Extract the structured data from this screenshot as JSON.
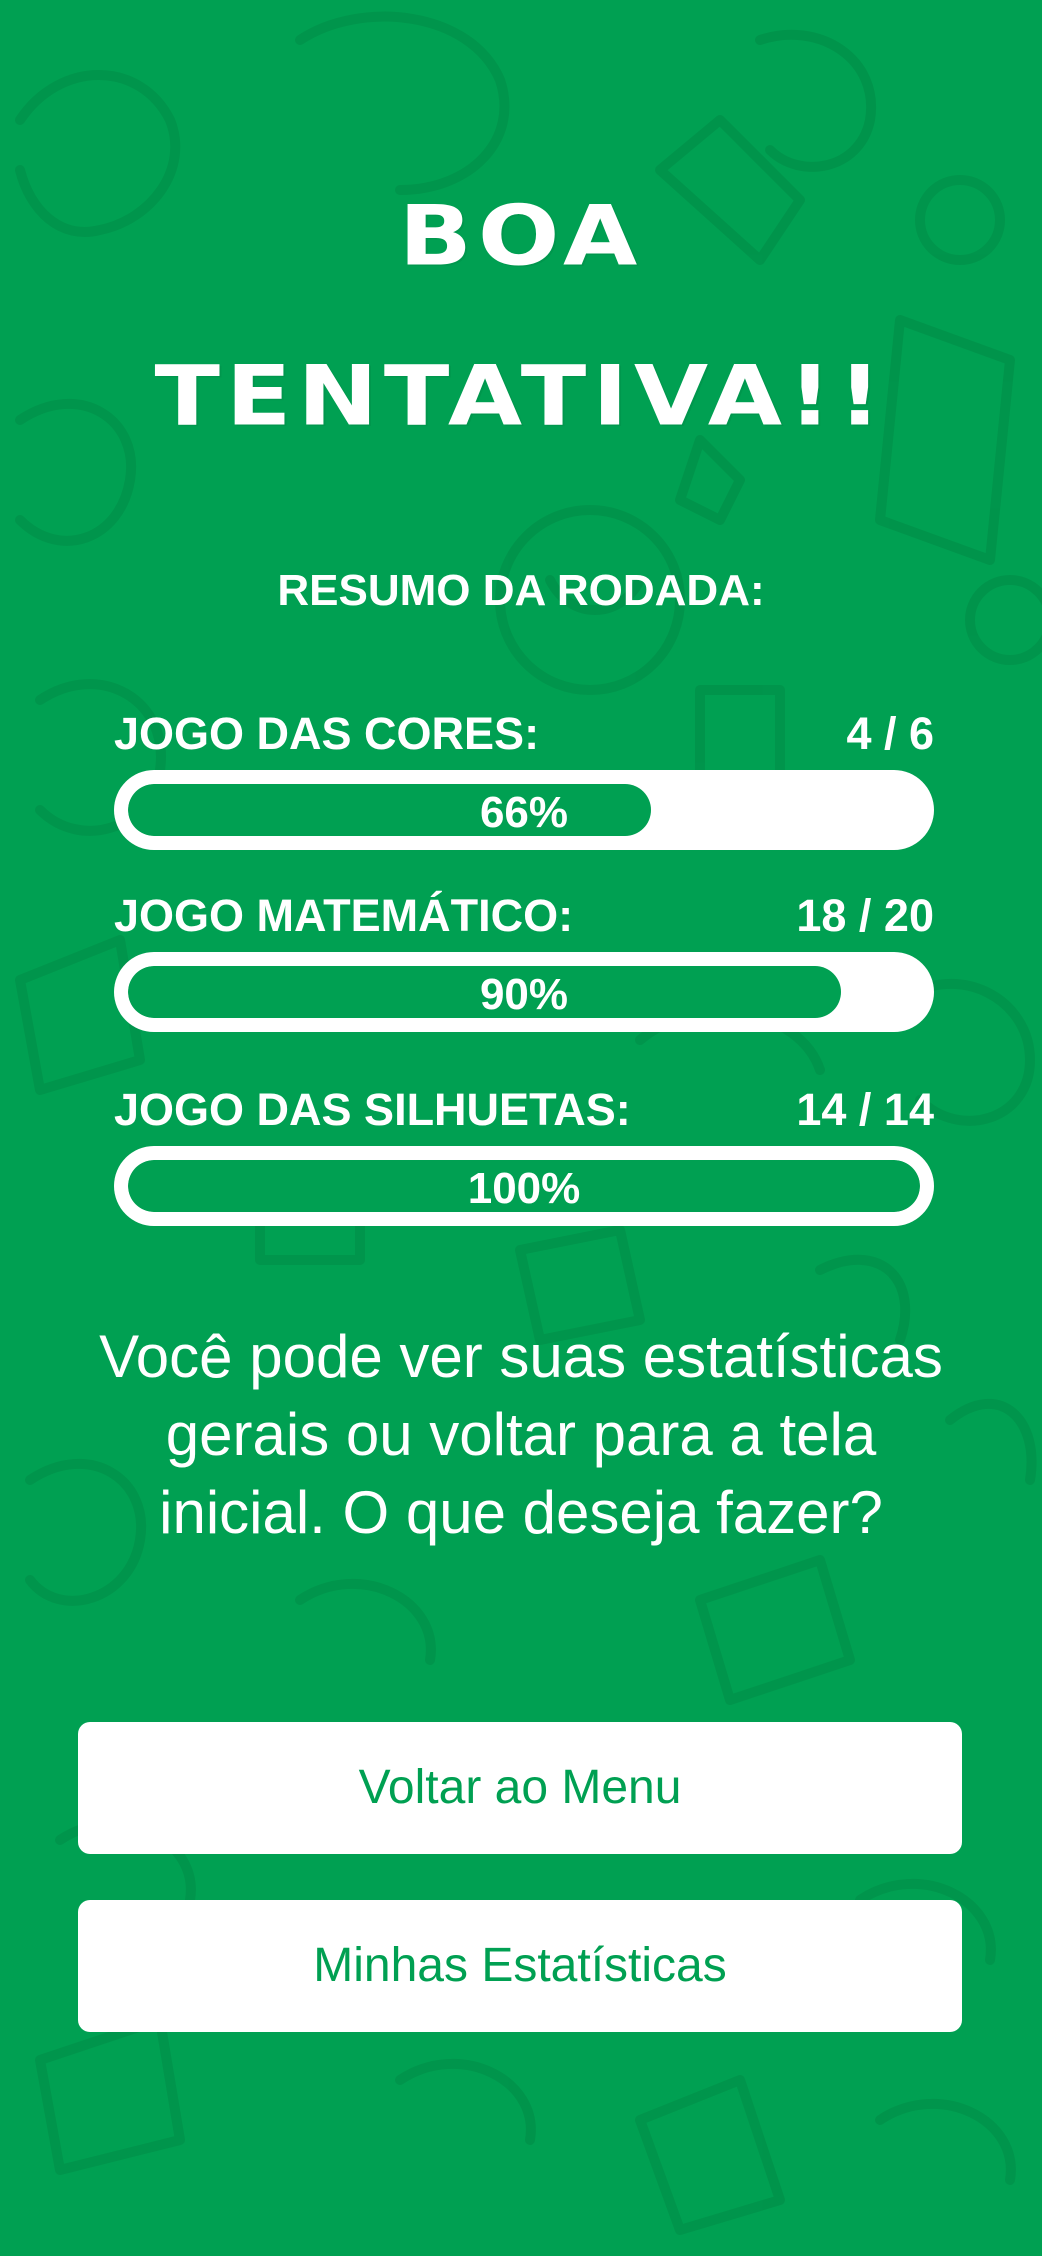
{
  "title": {
    "line1": "BOA",
    "line2": "TENTATIVA!!"
  },
  "subtitle": "RESUMO DA RODADA:",
  "games": [
    {
      "label": "JOGO DAS CORES:",
      "score": "4 / 6",
      "percent_text": "66%",
      "progress": 0.66
    },
    {
      "label": "JOGO MATEMÁTICO:",
      "score": "18 / 20",
      "percent_text": "90%",
      "progress": 0.9
    },
    {
      "label": "JOGO DAS SILHUETAS:",
      "score": "14 / 14",
      "percent_text": "100%",
      "progress": 1.0
    }
  ],
  "message": "Você pode ver suas estatísticas gerais ou voltar para a tela inicial. O que deseja fazer?",
  "buttons": {
    "menu_label": "Voltar ao Menu",
    "stats_label": "Minhas Estatísticas"
  },
  "colors": {
    "background": "#00a052",
    "text": "#ffffff",
    "button_text": "#00a052"
  }
}
